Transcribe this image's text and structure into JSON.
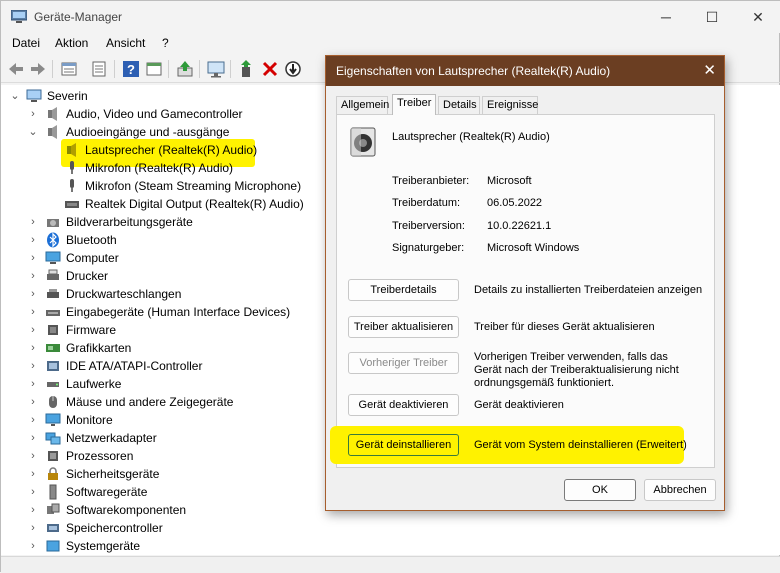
{
  "window": {
    "title": "Geräte-Manager",
    "minimize": "─",
    "maximize": "☐",
    "close": "✕"
  },
  "menu": [
    "Datei",
    "Aktion",
    "Ansicht",
    "?"
  ],
  "tree": {
    "root": "Severin",
    "items": [
      "Audio, Video und Gamecontroller",
      "Audioeingänge und -ausgänge",
      "Lautsprecher (Realtek(R) Audio)",
      "Mikrofon (Realtek(R) Audio)",
      "Mikrofon (Steam Streaming Microphone)",
      "Realtek Digital Output (Realtek(R) Audio)",
      "Bildverarbeitungsgeräte",
      "Bluetooth",
      "Computer",
      "Drucker",
      "Druckwarteschlangen",
      "Eingabegeräte (Human Interface Devices)",
      "Firmware",
      "Grafikkarten",
      "IDE ATA/ATAPI-Controller",
      "Laufwerke",
      "Mäuse und andere Zeigegeräte",
      "Monitore",
      "Netzwerkadapter",
      "Prozessoren",
      "Sicherheitsgeräte",
      "Softwaregeräte",
      "Softwarekomponenten",
      "Speichercontroller",
      "Systemgeräte"
    ]
  },
  "dialog": {
    "title": "Eigenschaften von Lautsprecher (Realtek(R) Audio)",
    "close": "✕",
    "tabs": [
      "Allgemein",
      "Treiber",
      "Details",
      "Ereignisse"
    ],
    "device_name": "Lautsprecher (Realtek(R) Audio)",
    "props": [
      {
        "label": "Treiberanbieter:",
        "value": "Microsoft"
      },
      {
        "label": "Treiberdatum:",
        "value": "06.05.2022"
      },
      {
        "label": "Treiberversion:",
        "value": "10.0.22621.1"
      },
      {
        "label": "Signaturgeber:",
        "value": "Microsoft Windows"
      }
    ],
    "buttons": [
      {
        "label": "Treiberdetails",
        "desc": "Details zu installierten Treiberdateien anzeigen"
      },
      {
        "label": "Treiber aktualisieren",
        "desc": "Treiber für dieses Gerät aktualisieren"
      },
      {
        "label": "Vorheriger Treiber",
        "desc": "Vorherigen Treiber verwenden, falls das Gerät nach der Treiberaktualisierung nicht ordnungsgemäß funktioniert."
      },
      {
        "label": "Gerät deaktivieren",
        "desc": "Gerät deaktivieren"
      },
      {
        "label": "Gerät deinstallieren",
        "desc": "Gerät vom System deinstallieren (Erweitert)"
      }
    ],
    "ok": "OK",
    "cancel": "Abbrechen"
  },
  "colors": {
    "highlight": "#fff200",
    "dialog_title": "#6b3e22",
    "delete_icon": "#d40000"
  }
}
